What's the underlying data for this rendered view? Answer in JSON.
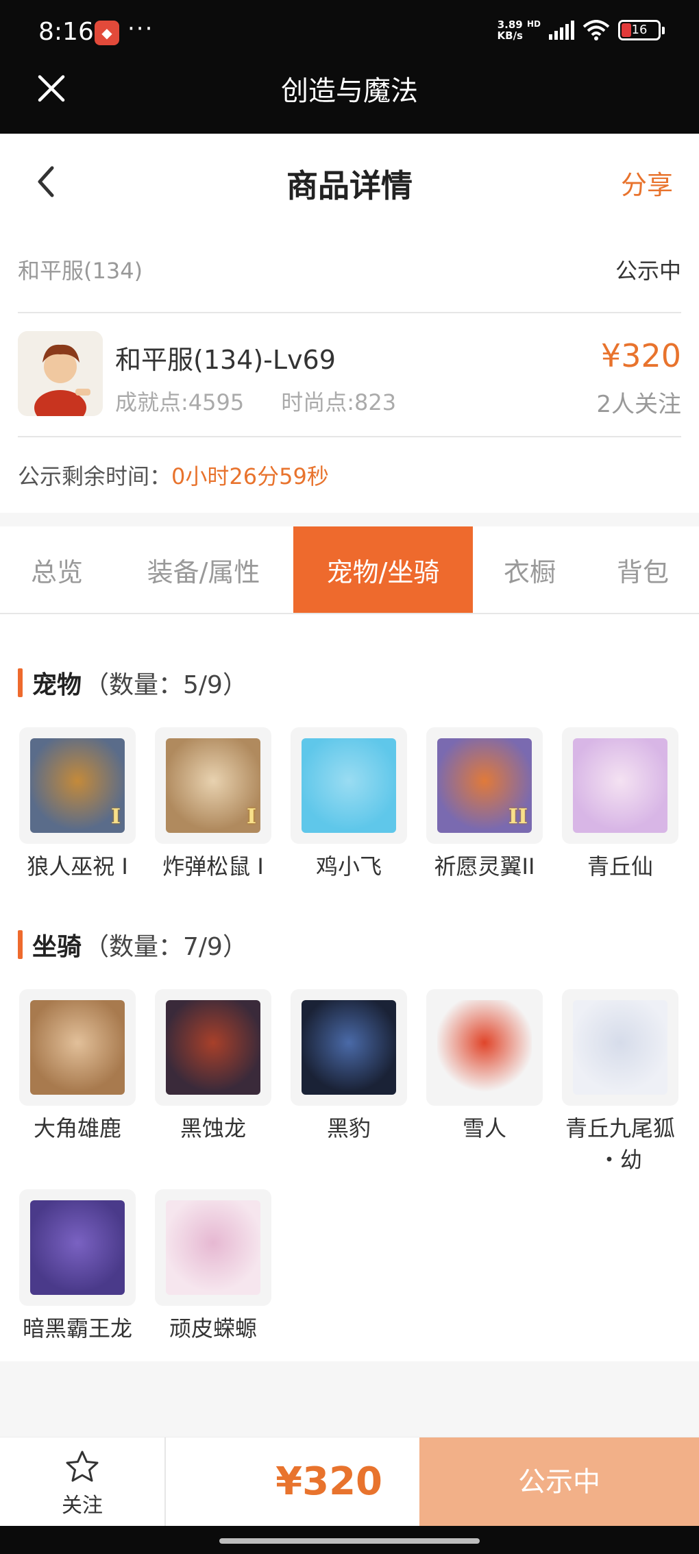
{
  "status_bar": {
    "time": "8:16",
    "app_icon": "red-app-icon",
    "more": "···",
    "net_speed_top": "3.89",
    "net_speed_bottom": "KB/s",
    "hd_label": "HD",
    "battery": "16"
  },
  "app_bar": {
    "title": "创造与魔法",
    "close_icon": "close-icon"
  },
  "header": {
    "title": "商品详情",
    "share_label": "分享",
    "back_icon": "chevron-left-icon"
  },
  "info": {
    "server": "和平服(134)",
    "status": "公示中",
    "character_name": "和平服(134)-Lv69",
    "achievement": "成就点:4595",
    "fashion": "时尚点:823",
    "price": "¥320",
    "followers": "2人关注",
    "countdown_label": "公示剩余时间：",
    "countdown_value": "0小时26分59秒"
  },
  "tabs": [
    {
      "label": "总览",
      "active": false
    },
    {
      "label": "装备/属性",
      "active": false
    },
    {
      "label": "宠物/坐骑",
      "active": true
    },
    {
      "label": "衣橱",
      "active": false
    },
    {
      "label": "背包",
      "active": false
    }
  ],
  "pets": {
    "title": "宠物",
    "count": "（数量：5/9）",
    "items": [
      {
        "label": "狼人巫祝 I",
        "rank": "I",
        "colors": [
          "#5a6c8a",
          "#c48a3a"
        ]
      },
      {
        "label": "炸弹松鼠 I",
        "rank": "I",
        "colors": [
          "#b08a5e",
          "#e8d2b0"
        ]
      },
      {
        "label": "鸡小飞",
        "rank": "",
        "colors": [
          "#5fc7ea",
          "#9adcf2"
        ]
      },
      {
        "label": "祈愿灵翼II",
        "rank": "II",
        "colors": [
          "#7a6ab0",
          "#e07a3a"
        ]
      },
      {
        "label": "青丘仙",
        "rank": "",
        "colors": [
          "#d8b6e6",
          "#f4e2f2"
        ]
      }
    ]
  },
  "mounts": {
    "title": "坐骑",
    "count": "（数量：7/9）",
    "items": [
      {
        "label": "大角雄鹿",
        "colors": [
          "#a87a4e",
          "#e2c09a"
        ]
      },
      {
        "label": "黑蚀龙",
        "colors": [
          "#3a2a3a",
          "#a8402a"
        ]
      },
      {
        "label": "黑豹",
        "colors": [
          "#1a2236",
          "#4a6aa8"
        ]
      },
      {
        "label": "雪人",
        "colors": [
          "#f4f4f4",
          "#e0452a"
        ]
      },
      {
        "label": "青丘九尾狐\n・幼",
        "colors": [
          "#eef0f6",
          "#d6dcea"
        ]
      },
      {
        "label": "暗黑霸王龙",
        "colors": [
          "#4a3a8a",
          "#7a62c2"
        ]
      },
      {
        "label": "顽皮蝾螈",
        "colors": [
          "#f6e6ee",
          "#e6b8d2"
        ]
      }
    ]
  },
  "bottom_bar": {
    "follow_label": "关注",
    "follow_icon": "star-outline-icon",
    "price": "¥320",
    "status": "公示中"
  },
  "colors": {
    "accent": "#ee6a2d",
    "accent_text": "#e8732d",
    "disabled_button": "#f2b088"
  }
}
